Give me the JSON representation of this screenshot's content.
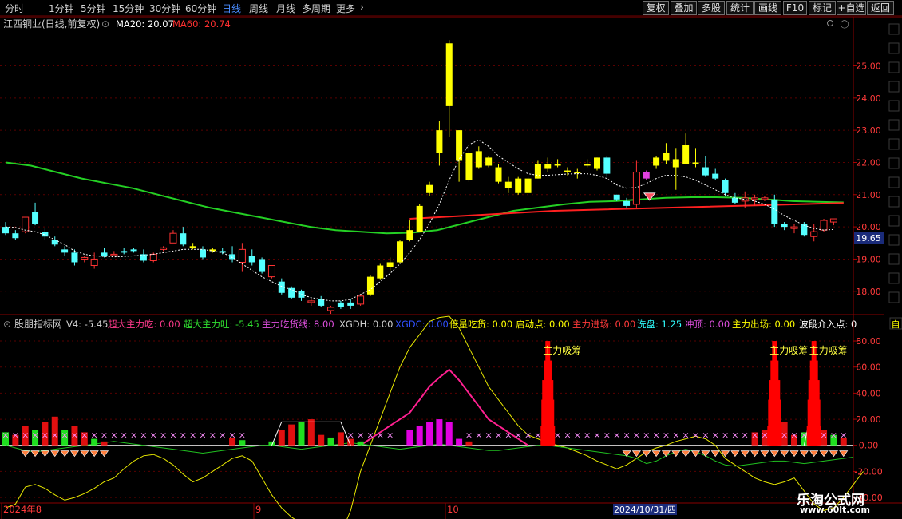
{
  "toolbar": {
    "periods": [
      {
        "label": "分时",
        "active": false
      },
      {
        "label": "1分钟",
        "active": false
      },
      {
        "label": "5分钟",
        "active": false
      },
      {
        "label": "15分钟",
        "active": false
      },
      {
        "label": "30分钟",
        "active": false
      },
      {
        "label": "60分钟",
        "active": false
      },
      {
        "label": "日线",
        "active": true
      },
      {
        "label": "周线",
        "active": false
      },
      {
        "label": "月线",
        "active": false
      },
      {
        "label": "多周期",
        "active": false
      },
      {
        "label": "更多",
        "active": false
      }
    ],
    "right_buttons": [
      "复权",
      "叠加",
      "多股",
      "统计",
      "画线",
      "F10",
      "标记",
      "+自选",
      "返回"
    ]
  },
  "main_panel": {
    "title": "江西铜业(日线,前复权)",
    "ma20_label": "MA20: 20.07",
    "ma60_label": "MA60: 20.74",
    "last_price_tag": "19.65",
    "colors": {
      "up": "#ff3333",
      "down": "#54ffff",
      "bull_yellow": "#ffff00",
      "ma60": "#ff2020",
      "long_ma": "#20d020",
      "ma20": "#ffffff"
    }
  },
  "indicator_panel": {
    "name": "股朋指标网",
    "values": [
      {
        "label": "V4: -5.45",
        "color": "#d0d0d0"
      },
      {
        "label": "超大主力吃: 0.00",
        "color": "#ff3a8c"
      },
      {
        "label": "超大主力吐: -5.45",
        "color": "#30e030"
      },
      {
        "label": "主力吃货线: 8.00",
        "color": "#e050e0"
      },
      {
        "label": "XGDH: 0.00",
        "color": "#d0d0d0"
      },
      {
        "label": "XGDC: 0.00",
        "color": "#3050ff"
      },
      {
        "label": "倍量吃货: 0.00",
        "color": "#ffff00"
      },
      {
        "label": "启动点: 0.00",
        "color": "#ffff00"
      },
      {
        "label": "主力进场: 0.00",
        "color": "#ff3a3a"
      },
      {
        "label": "洗盘: 1.25",
        "color": "#30ffff"
      },
      {
        "label": "冲顶: 0.00",
        "color": "#e050e0"
      },
      {
        "label": "主力出场: 0.00",
        "color": "#ffff00"
      },
      {
        "label": "波段介入点: 0",
        "color": "#ffffff"
      }
    ],
    "signal_label": "主力吸筹"
  },
  "date_axis": {
    "labels": [
      "2024年8",
      "9",
      "10"
    ],
    "cursor_label": "2024/10/31/四"
  },
  "watermark": {
    "line1": "乐淘公式网",
    "line2": "www.60lt.com"
  },
  "chart_data": [
    {
      "type": "candlestick",
      "title": "江西铜业(日线,前复权)",
      "yticks": [
        18.0,
        19.0,
        20.0,
        21.0,
        22.0,
        23.0,
        24.0,
        25.0
      ],
      "ylim": [
        17.3,
        26.5
      ],
      "candles": [
        {
          "o": 20.0,
          "h": 20.15,
          "l": 19.75,
          "c": 19.8,
          "k": "d"
        },
        {
          "o": 19.8,
          "h": 19.9,
          "l": 19.6,
          "c": 19.65,
          "k": "d"
        },
        {
          "o": 19.85,
          "h": 20.15,
          "l": 19.8,
          "c": 20.3,
          "k": "u"
        },
        {
          "o": 20.45,
          "h": 20.75,
          "l": 20.05,
          "c": 20.1,
          "k": "d"
        },
        {
          "o": 19.85,
          "h": 19.95,
          "l": 19.6,
          "c": 19.7,
          "k": "d"
        },
        {
          "o": 19.6,
          "h": 19.7,
          "l": 19.4,
          "c": 19.45,
          "k": "d"
        },
        {
          "o": 19.3,
          "h": 19.4,
          "l": 19.1,
          "c": 19.2,
          "k": "d"
        },
        {
          "o": 19.2,
          "h": 19.3,
          "l": 18.8,
          "c": 18.9,
          "k": "d"
        },
        {
          "o": 19.0,
          "h": 19.1,
          "l": 18.9,
          "c": 19.05,
          "k": "u"
        },
        {
          "o": 18.8,
          "h": 19.2,
          "l": 18.7,
          "c": 19.0,
          "k": "u"
        },
        {
          "o": 19.1,
          "h": 19.35,
          "l": 19.05,
          "c": 19.2,
          "k": "d"
        },
        {
          "o": 19.15,
          "h": 19.25,
          "l": 19.1,
          "c": 19.15,
          "k": "u"
        },
        {
          "o": 19.25,
          "h": 19.35,
          "l": 19.15,
          "c": 19.2,
          "k": "d"
        },
        {
          "o": 19.25,
          "h": 19.35,
          "l": 19.2,
          "c": 19.3,
          "k": "d"
        },
        {
          "o": 19.15,
          "h": 19.3,
          "l": 18.9,
          "c": 18.95,
          "k": "d"
        },
        {
          "o": 18.95,
          "h": 19.2,
          "l": 18.9,
          "c": 19.15,
          "k": "u"
        },
        {
          "o": 19.3,
          "h": 19.4,
          "l": 19.25,
          "c": 19.35,
          "k": "u"
        },
        {
          "o": 19.5,
          "h": 19.9,
          "l": 19.5,
          "c": 19.8,
          "k": "u"
        },
        {
          "o": 19.8,
          "h": 20.0,
          "l": 19.4,
          "c": 19.45,
          "k": "d"
        },
        {
          "o": 19.35,
          "h": 19.5,
          "l": 19.3,
          "c": 19.4,
          "k": "y"
        },
        {
          "o": 19.3,
          "h": 19.4,
          "l": 19.0,
          "c": 19.05,
          "k": "d"
        },
        {
          "o": 19.25,
          "h": 19.35,
          "l": 19.2,
          "c": 19.3,
          "k": "y"
        },
        {
          "o": 19.25,
          "h": 19.35,
          "l": 19.15,
          "c": 19.2,
          "k": "d"
        },
        {
          "o": 19.15,
          "h": 19.4,
          "l": 18.9,
          "c": 19.0,
          "k": "d"
        },
        {
          "o": 18.9,
          "h": 19.5,
          "l": 18.6,
          "c": 19.3,
          "k": "u"
        },
        {
          "o": 19.1,
          "h": 19.3,
          "l": 18.8,
          "c": 18.9,
          "k": "d"
        },
        {
          "o": 19.0,
          "h": 19.05,
          "l": 18.55,
          "c": 18.6,
          "k": "d"
        },
        {
          "o": 18.8,
          "h": 18.8,
          "l": 18.4,
          "c": 18.45,
          "k": "u"
        },
        {
          "o": 18.3,
          "h": 18.4,
          "l": 17.9,
          "c": 17.95,
          "k": "d"
        },
        {
          "o": 18.1,
          "h": 18.15,
          "l": 17.75,
          "c": 17.8,
          "k": "d"
        },
        {
          "o": 18.0,
          "h": 18.05,
          "l": 17.7,
          "c": 17.8,
          "k": "d"
        },
        {
          "o": 17.65,
          "h": 17.75,
          "l": 17.55,
          "c": 17.7,
          "k": "u"
        },
        {
          "o": 17.75,
          "h": 17.85,
          "l": 17.5,
          "c": 17.55,
          "k": "d"
        },
        {
          "o": 17.4,
          "h": 17.55,
          "l": 17.3,
          "c": 17.5,
          "k": "u"
        },
        {
          "o": 17.5,
          "h": 17.7,
          "l": 17.45,
          "c": 17.65,
          "k": "d"
        },
        {
          "o": 17.65,
          "h": 17.75,
          "l": 17.45,
          "c": 17.55,
          "k": "d"
        },
        {
          "o": 17.6,
          "h": 17.9,
          "l": 17.55,
          "c": 17.85,
          "k": "u"
        },
        {
          "o": 17.9,
          "h": 18.5,
          "l": 17.85,
          "c": 18.45,
          "k": "y"
        },
        {
          "o": 18.4,
          "h": 18.85,
          "l": 18.35,
          "c": 18.8,
          "k": "y"
        },
        {
          "o": 18.75,
          "h": 19.05,
          "l": 18.65,
          "c": 18.9,
          "k": "y"
        },
        {
          "o": 18.9,
          "h": 19.6,
          "l": 18.85,
          "c": 19.55,
          "k": "y"
        },
        {
          "o": 19.6,
          "h": 20.2,
          "l": 19.55,
          "c": 19.9,
          "k": "y"
        },
        {
          "o": 19.85,
          "h": 20.7,
          "l": 19.85,
          "c": 20.65,
          "k": "y"
        },
        {
          "o": 21.05,
          "h": 21.4,
          "l": 20.95,
          "c": 21.3,
          "k": "y"
        },
        {
          "o": 22.3,
          "h": 23.3,
          "l": 21.9,
          "c": 23.0,
          "k": "y"
        },
        {
          "o": 23.75,
          "h": 25.8,
          "l": 22.8,
          "c": 25.7,
          "k": "y"
        },
        {
          "o": 23.0,
          "h": 23.0,
          "l": 21.4,
          "c": 22.05,
          "k": "y"
        },
        {
          "o": 22.3,
          "h": 22.5,
          "l": 21.4,
          "c": 21.45,
          "k": "y"
        },
        {
          "o": 22.35,
          "h": 22.5,
          "l": 21.8,
          "c": 21.85,
          "k": "y"
        },
        {
          "o": 22.15,
          "h": 22.2,
          "l": 21.85,
          "c": 21.9,
          "k": "y"
        },
        {
          "o": 21.85,
          "h": 21.95,
          "l": 21.35,
          "c": 21.4,
          "k": "y"
        },
        {
          "o": 21.4,
          "h": 21.55,
          "l": 21.05,
          "c": 21.2,
          "k": "y"
        },
        {
          "o": 21.5,
          "h": 21.55,
          "l": 21.0,
          "c": 21.05,
          "k": "y"
        },
        {
          "o": 21.5,
          "h": 21.55,
          "l": 21.05,
          "c": 21.05,
          "k": "y"
        },
        {
          "o": 21.95,
          "h": 22.05,
          "l": 21.5,
          "c": 21.5,
          "k": "y"
        },
        {
          "o": 21.95,
          "h": 22.15,
          "l": 21.7,
          "c": 21.8,
          "k": "y"
        },
        {
          "o": 21.95,
          "h": 22.1,
          "l": 21.85,
          "c": 21.9,
          "k": "y"
        },
        {
          "o": 21.75,
          "h": 21.85,
          "l": 21.6,
          "c": 21.7,
          "k": "y"
        },
        {
          "o": 21.7,
          "h": 21.8,
          "l": 21.5,
          "c": 21.7,
          "k": "y"
        },
        {
          "o": 21.95,
          "h": 22.1,
          "l": 21.85,
          "c": 21.9,
          "k": "y"
        },
        {
          "o": 22.15,
          "h": 22.15,
          "l": 21.75,
          "c": 21.8,
          "k": "y"
        },
        {
          "o": 22.15,
          "h": 22.2,
          "l": 21.55,
          "c": 21.65,
          "k": "d"
        },
        {
          "o": 21.0,
          "h": 21.0,
          "l": 20.8,
          "c": 20.85,
          "k": "d"
        },
        {
          "o": 20.8,
          "h": 20.9,
          "l": 20.6,
          "c": 20.65,
          "k": "d"
        },
        {
          "o": 20.7,
          "h": 22.05,
          "l": 20.6,
          "c": 21.7,
          "k": "u"
        },
        {
          "o": 21.7,
          "h": 21.75,
          "l": 21.45,
          "c": 21.5,
          "k": "m"
        },
        {
          "o": 21.9,
          "h": 22.2,
          "l": 21.8,
          "c": 22.15,
          "k": "y"
        },
        {
          "o": 22.3,
          "h": 22.6,
          "l": 21.95,
          "c": 22.05,
          "k": "y"
        },
        {
          "o": 22.1,
          "h": 22.45,
          "l": 21.15,
          "c": 21.85,
          "k": "y"
        },
        {
          "o": 21.95,
          "h": 22.9,
          "l": 21.95,
          "c": 22.55,
          "k": "y"
        },
        {
          "o": 22.0,
          "h": 22.45,
          "l": 21.85,
          "c": 22.0,
          "k": "y"
        },
        {
          "o": 21.85,
          "h": 22.2,
          "l": 21.55,
          "c": 21.6,
          "k": "d"
        },
        {
          "o": 21.65,
          "h": 21.8,
          "l": 21.45,
          "c": 21.5,
          "k": "d"
        },
        {
          "o": 21.45,
          "h": 21.5,
          "l": 20.95,
          "c": 21.05,
          "k": "d"
        },
        {
          "o": 20.9,
          "h": 21.05,
          "l": 20.7,
          "c": 20.75,
          "k": "d"
        },
        {
          "o": 20.8,
          "h": 21.1,
          "l": 20.6,
          "c": 20.9,
          "k": "u"
        },
        {
          "o": 20.85,
          "h": 21.0,
          "l": 20.65,
          "c": 20.9,
          "k": "u"
        },
        {
          "o": 20.9,
          "h": 20.95,
          "l": 20.8,
          "c": 20.85,
          "k": "u"
        },
        {
          "o": 20.85,
          "h": 21.0,
          "l": 20.0,
          "c": 20.1,
          "k": "d"
        },
        {
          "o": 20.1,
          "h": 20.15,
          "l": 19.9,
          "c": 20.0,
          "k": "d"
        },
        {
          "o": 19.95,
          "h": 20.1,
          "l": 19.8,
          "c": 20.0,
          "k": "u"
        },
        {
          "o": 20.1,
          "h": 20.15,
          "l": 19.7,
          "c": 19.75,
          "k": "d"
        },
        {
          "o": 19.7,
          "h": 20.1,
          "l": 19.55,
          "c": 19.85,
          "k": "u"
        },
        {
          "o": 19.9,
          "h": 20.25,
          "l": 19.85,
          "c": 20.2,
          "k": "u"
        },
        {
          "o": 20.15,
          "h": 20.25,
          "l": 20.05,
          "c": 20.25,
          "k": "u"
        }
      ],
      "ma20": [
        20.0,
        19.98,
        19.9,
        19.85,
        19.75,
        19.6,
        19.45,
        19.25,
        19.15,
        19.1,
        19.08,
        19.07,
        19.08,
        19.1,
        19.12,
        19.15,
        19.2,
        19.25,
        19.3,
        19.3,
        19.3,
        19.25,
        19.2,
        19.05,
        18.85,
        18.65,
        18.45,
        18.3,
        18.15,
        18.05,
        17.9,
        17.8,
        17.75,
        17.7,
        17.7,
        17.75,
        17.9,
        18.05,
        18.3,
        18.55,
        18.85,
        19.2,
        19.6,
        20.1,
        20.7,
        21.45,
        22.1,
        22.55,
        22.7,
        22.5,
        22.2,
        22.0,
        21.8,
        21.65,
        21.6,
        21.6,
        21.62,
        21.64,
        21.65,
        21.65,
        21.6,
        21.5,
        21.3,
        21.2,
        21.22,
        21.35,
        21.5,
        21.6,
        21.6,
        21.55,
        21.45,
        21.3,
        21.15,
        21.0,
        20.9,
        20.85,
        20.8,
        20.7,
        20.55,
        20.35,
        20.2,
        20.05,
        19.95,
        19.9,
        19.92
      ],
      "ma60": [
        20.25,
        20.5,
        20.62,
        20.74
      ],
      "ma60_x_range": [
        41,
        85
      ],
      "long_ma": [
        22.0,
        21.9,
        21.7,
        21.5,
        21.35,
        21.2,
        21.0,
        20.8,
        20.6,
        20.45,
        20.3,
        20.15,
        20.0,
        19.9,
        19.85,
        19.8,
        19.82,
        19.9,
        20.1,
        20.3,
        20.5,
        20.6,
        20.7,
        20.78,
        20.8,
        20.85,
        20.9,
        20.92,
        20.92,
        20.9,
        20.85,
        20.8,
        20.78,
        20.76
      ],
      "signal_marker": {
        "index": 65,
        "value": 21.0
      }
    },
    {
      "type": "bar",
      "title": "股朋指标网",
      "yticks": [
        -40.0,
        -20.0,
        0.0,
        20.0,
        40.0,
        60.0,
        80.0
      ],
      "ylim": [
        -43,
        99
      ],
      "spikes_index": [
        55,
        78,
        82
      ],
      "spike_value": 80,
      "yellow_line": [
        -48,
        -45,
        -32,
        -30,
        -33,
        -38,
        -42,
        -40,
        -37,
        -33,
        -28,
        -25,
        -18,
        -12,
        -8,
        -7,
        -10,
        -15,
        -22,
        -28,
        -25,
        -20,
        -15,
        -10,
        -8,
        -12,
        -25,
        -38,
        -48,
        -55,
        -60,
        -65,
        -68,
        -70,
        -68,
        -50,
        -20,
        0,
        20,
        40,
        60,
        75,
        85,
        95,
        98,
        99,
        90,
        75,
        60,
        45,
        35,
        25,
        15,
        8,
        5,
        2,
        0,
        -2,
        -5,
        -8,
        -12,
        -15,
        -18,
        -15,
        -10,
        -5,
        -2,
        0,
        3,
        5,
        7,
        5,
        0,
        -10,
        -15,
        -20,
        -25,
        -28,
        -30,
        -28,
        -25,
        -35,
        -45,
        -50,
        -48,
        -40,
        -30,
        -20
      ],
      "magenta_line": [
        null,
        null,
        null,
        null,
        null,
        null,
        null,
        null,
        null,
        null,
        null,
        null,
        null,
        null,
        null,
        null,
        null,
        null,
        null,
        null,
        null,
        null,
        null,
        null,
        null,
        null,
        null,
        null,
        null,
        null,
        null,
        null,
        null,
        null,
        null,
        null,
        0,
        5,
        10,
        15,
        20,
        25,
        35,
        45,
        52,
        58,
        50,
        40,
        30,
        20,
        15,
        10,
        5,
        0,
        null,
        null,
        null,
        null,
        null,
        null,
        null,
        null,
        null,
        null,
        null,
        null,
        null,
        null,
        null,
        null,
        null,
        null,
        null,
        null,
        null,
        null,
        null,
        null,
        null,
        null,
        null,
        null,
        null,
        null,
        null,
        null,
        null
      ],
      "green_line": [
        0,
        -2,
        -4,
        -5,
        -4,
        -3,
        -2,
        -1,
        0,
        1,
        2,
        3,
        2,
        1,
        0,
        -1,
        -2,
        -3,
        -4,
        -5,
        -6,
        -5,
        -4,
        -3,
        -2,
        -1,
        0,
        0,
        -1,
        -2,
        -3,
        -2,
        -1,
        0,
        1,
        2,
        1,
        0,
        -1,
        -2,
        -3,
        -2,
        -1,
        0,
        1,
        0,
        -1,
        -2,
        -3,
        -4,
        -4,
        -3,
        -2,
        -1,
        0,
        0,
        -1,
        -2,
        -3,
        -4,
        -5,
        -6,
        -7,
        -8,
        -10,
        -14,
        -12,
        -8,
        -5,
        -3,
        -5,
        -8,
        -12,
        -15,
        -16,
        -15,
        -14,
        -13,
        -12,
        -12,
        -13,
        -14,
        -13,
        -12,
        -11,
        -10,
        -9
      ]
    }
  ]
}
